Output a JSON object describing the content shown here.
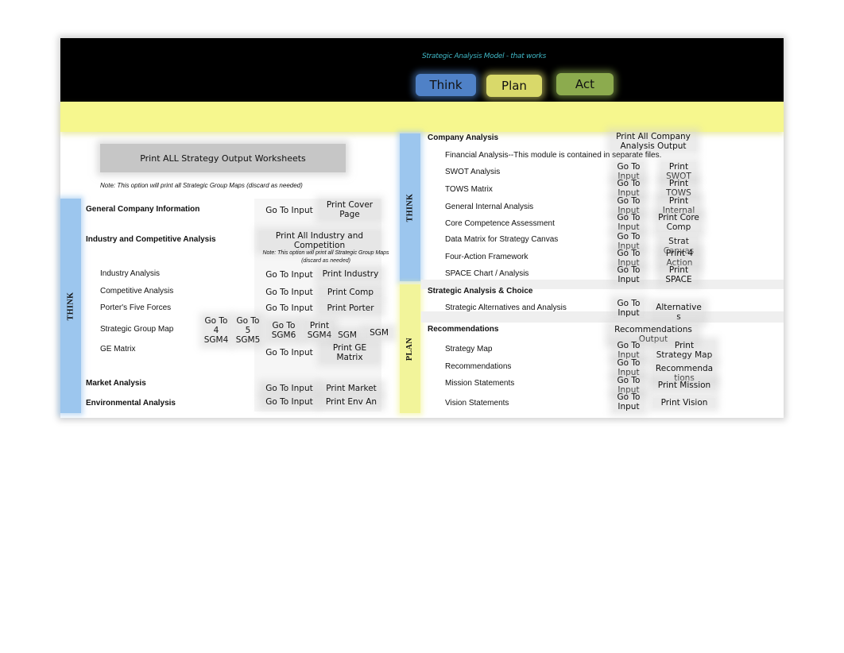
{
  "header": {
    "tagline": "Strategic Analysis Model - that works",
    "nav": [
      {
        "label": "Think",
        "color": "#4f81c7"
      },
      {
        "label": "Plan",
        "color": "#d9d96a"
      },
      {
        "label": "Act",
        "color": "#8cab4e"
      }
    ]
  },
  "left": {
    "print_all_label": "Print ALL Strategy Output Worksheets",
    "print_all_note": "Note:  This option will print all Strategic Group Maps (discard as needed)",
    "band_label": "THINK",
    "general": {
      "title": "General Company Information",
      "go_to_input": "Go To Input",
      "print": "Print Cover\nPage"
    },
    "industry": {
      "title": "Industry and Competitive Analysis",
      "print_all": "Print All Industry and\nCompetition",
      "note": "Note:  This option will print all Strategic Group Maps\n(discard as needed)",
      "items": [
        {
          "label": "Industry Analysis",
          "go": "Go To Input",
          "print": "Print Industry"
        },
        {
          "label": "Competitive Analysis",
          "go": "Go To Input",
          "print": "Print Comp"
        },
        {
          "label": "Porter's Five Forces",
          "go": "Go To Input",
          "print": "Print Porter"
        }
      ],
      "sgm": {
        "label": "Strategic Group  Map",
        "buttons": [
          "Go To\n4\nSGM4",
          "Go To\n5\nSGM5",
          "Go To\nSGM6",
          "Print\nSGM4",
          "SGM",
          "SGM"
        ]
      },
      "ge": {
        "label": "GE Matrix",
        "go": "Go To Input",
        "print": "Print GE\nMatrix"
      }
    },
    "market": {
      "title": "Market Analysis",
      "go": "Go To Input",
      "print": "Print Market"
    },
    "environmental": {
      "title": "Environmental Analysis",
      "go": "Go To Input",
      "print": "Print Env An"
    }
  },
  "right": {
    "think_band": "THINK",
    "plan_band": "PLAN",
    "company": {
      "title": "Company Analysis",
      "print_all": "Print All Company\nAnalysis Output",
      "financial_note": "Financial Analysis--This module is contained in separate files.",
      "items": [
        {
          "label": "SWOT Analysis",
          "go": "Go To\nInput",
          "print": "Print\nSWOT"
        },
        {
          "label": "TOWS Matrix",
          "go": "Go To\nInput",
          "print": "Print\nTOWS"
        },
        {
          "label": "General Internal Analysis",
          "go": "Go To\nInput",
          "print": "Print\nInternal"
        },
        {
          "label": "Core Competence Assessment",
          "go": "Go To\nInput",
          "print": "Print Core\nComp"
        },
        {
          "label": "Data Matrix for Strategy Canvas",
          "go": "Go To\nInput",
          "print": "Strat\nCanvas"
        },
        {
          "label": "Four-Action Framework",
          "go": "Go To\nInput",
          "print": "Print 4\nAction"
        },
        {
          "label": "SPACE Chart / Analysis",
          "go": "Go To\nInput",
          "print": "Print\nSPACE"
        }
      ]
    },
    "strategic": {
      "title": "Strategic Analysis & Choice",
      "items": [
        {
          "label": "Strategic Alternatives and Analysis",
          "go": "Go To\nInput",
          "print": "Alternative\ns"
        }
      ]
    },
    "recommendations": {
      "title": "Recommendations",
      "print_all": "Recommendations\nOutput",
      "items": [
        {
          "label": "Strategy Map",
          "go": "Go To\nInput",
          "print": "Print\nStrategy Map"
        },
        {
          "label": "Recommendations",
          "go": "Go To\nInput",
          "print": "Recommenda\ntions"
        },
        {
          "label": "Mission Statements",
          "go": "Go To\nInput",
          "print": "Print Mission"
        },
        {
          "label": "Vision Statements",
          "go": "Go To\nInput",
          "print": "Print Vision"
        }
      ]
    }
  }
}
